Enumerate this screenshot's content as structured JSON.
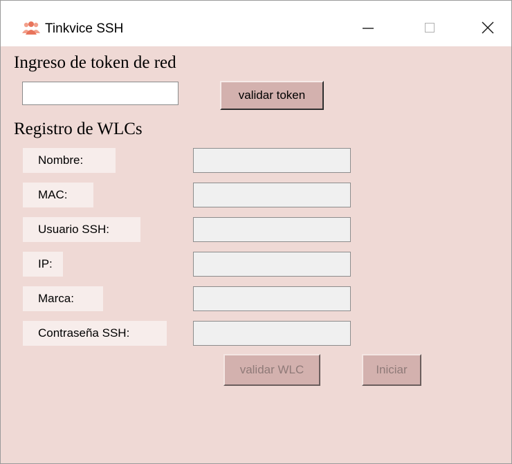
{
  "window": {
    "title": "Tinkvice SSH",
    "app_icon": "people-group-icon",
    "controls": {
      "minimize_icon": "minimize-icon",
      "maximize_icon": "maximize-icon",
      "close_icon": "close-icon"
    }
  },
  "colors": {
    "window_background": "#efd9d5",
    "button_background": "#d3b1ae",
    "label_background": "#f7edeb",
    "disabled_text": "#8f7a78",
    "icon_accent": "#e8745b"
  },
  "token_section": {
    "heading": "Ingreso de token de red",
    "token_value": "",
    "validate_button": "validar token"
  },
  "wlc_section": {
    "heading": "Registro de WLCs",
    "fields": [
      {
        "label": "Nombre:",
        "value": ""
      },
      {
        "label": "MAC:",
        "value": ""
      },
      {
        "label": "Usuario SSH:",
        "value": ""
      },
      {
        "label": "IP:",
        "value": ""
      },
      {
        "label": "Marca:",
        "value": ""
      },
      {
        "label": "Contraseña SSH:",
        "value": ""
      }
    ],
    "validate_button": "validar WLC",
    "start_button": "Iniciar"
  }
}
